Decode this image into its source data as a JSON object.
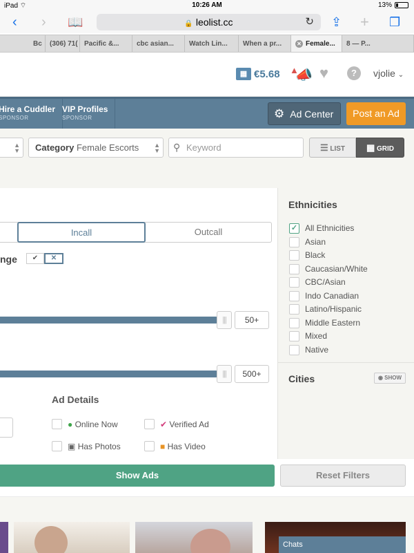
{
  "status_bar": {
    "device": "iPad",
    "time": "10:26 AM",
    "battery": "13%"
  },
  "browser": {
    "url": "leolist.cc",
    "tabs": [
      {
        "label": "Bc"
      },
      {
        "label": "(306) 71("
      },
      {
        "label": "Pacific &..."
      },
      {
        "label": "cbc asian..."
      },
      {
        "label": "Watch Lin..."
      },
      {
        "label": "When a pr..."
      },
      {
        "label": "Female...",
        "active": true
      },
      {
        "label": "8 — P..."
      }
    ]
  },
  "header": {
    "credits": "€5.68",
    "username": "vjolie"
  },
  "nav": {
    "items": [
      {
        "title": "Hire a Cuddler",
        "sub": "SPONSOR"
      },
      {
        "title": "VIP Profiles",
        "sub": "SPONSOR"
      }
    ],
    "ad_center": "Ad Center",
    "post_ad": "Post an Ad"
  },
  "search": {
    "category_label": "Category",
    "category_value": "Female Escorts",
    "keyword_placeholder": "Keyword",
    "list_label": "LIST",
    "grid_label": "GRID"
  },
  "filters": {
    "incall": "Incall",
    "outcall": "Outcall",
    "range_label": "nge",
    "slider1_value": "50+",
    "slider2_value": "500+",
    "ad_details_title": "Ad Details",
    "ad_details": [
      {
        "label": "Online Now",
        "icon": "person-icon"
      },
      {
        "label": "Verified Ad",
        "icon": "verified-icon"
      },
      {
        "label": "Has Photos",
        "icon": "camera-icon"
      },
      {
        "label": "Has Video",
        "icon": "video-icon"
      }
    ],
    "show_ads": "Show Ads",
    "reset_filters": "Reset Filters"
  },
  "sidebar": {
    "ethnicities_title": "Ethnicities",
    "ethnicities": [
      {
        "label": "All Ethnicities",
        "checked": true
      },
      {
        "label": "Asian",
        "checked": false
      },
      {
        "label": "Black",
        "checked": false
      },
      {
        "label": "Caucasian/White",
        "checked": false
      },
      {
        "label": "CBC/Asian",
        "checked": false
      },
      {
        "label": "Indo Canadian",
        "checked": false
      },
      {
        "label": "Latino/Hispanic",
        "checked": false
      },
      {
        "label": "Middle Eastern",
        "checked": false
      },
      {
        "label": "Mixed",
        "checked": false
      },
      {
        "label": "Native",
        "checked": false
      }
    ],
    "cities_title": "Cities",
    "show_label": "SHOW"
  },
  "footer": {
    "chats": "Chats"
  },
  "colors": {
    "nav_blue": "#5d7f98",
    "post_orange": "#f09a26",
    "show_green": "#4fa384"
  }
}
